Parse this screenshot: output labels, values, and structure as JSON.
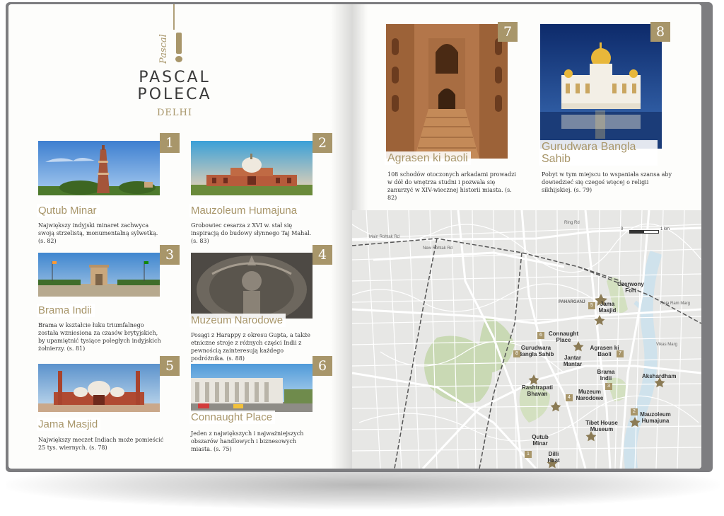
{
  "header": {
    "logo_text": "Pascal",
    "title_line1": "PASCAL",
    "title_line2": "POLECA",
    "city": "DELHI"
  },
  "attractions": [
    {
      "number": "1",
      "name": "Qutub Minar",
      "description": "Największy indyjski minaret zachwyca swoją strzelistą, monumentalną sylwetką. (s. 82)"
    },
    {
      "number": "2",
      "name": "Mauzoleum Humajuna",
      "description": "Grobowiec cesarza z XVI w. stał się inspiracją do budowy słynnego Taj Mahal. (s. 83)"
    },
    {
      "number": "3",
      "name": "Brama Indii",
      "description": "Brama w kształcie łuku triumfalnego została wzniesiona za czasów brytyjskich, by upamiętnić tysiące poległych indyjskich żołnierzy. (s. 81)"
    },
    {
      "number": "4",
      "name": "Muzeum Narodowe",
      "description": "Posągi z Harappy z okresu Gupta, a także etniczne stroje z różnych części Indii z pewnością zainteresują każdego podróżnika. (s. 88)"
    },
    {
      "number": "5",
      "name": "Jama Masjid",
      "description": "Największy meczet Indiach może pomieścić 25 tys. wiernych. (s. 78)"
    },
    {
      "number": "6",
      "name": "Connaught Place",
      "description": "Jeden z największych i najważniejszych obszarów handlowych i biznesowych miasta. (s. 75)"
    },
    {
      "number": "7",
      "name": "Agrasen ki baoli",
      "description": "108 schodów otoczonych arkadami prowadzi w dół do wnętrza studni i pozwala się zanurzyć w XIV-wiecznej historii miasta. (s. 82)"
    },
    {
      "number": "8",
      "name": "Gurudwara Bangla Sahib",
      "description": "Pobyt w tym miejscu to wspaniała szansa aby dowiedzieć się czegoś więcej o religii sikhijskiej. (s. 79)"
    }
  ],
  "map": {
    "scale_start": "0",
    "scale_end": "1 km",
    "labels": {
      "czerwony_fort": "Czerwony Fort",
      "jama_masjid": "Jama Masjid",
      "connaught_place": "Connaught Place",
      "gurudwara": "Gurudwara Bangla Sahib",
      "agrasen": "Agrasen ki Baoli",
      "jantar_mantar": "Jantar Mantar",
      "brama_indii": "Brama Indii",
      "rashtrapati": "Rashtrapati Bhavan",
      "muzeum": "Muzeum Narodowe",
      "akshardham": "Akshardham",
      "tibet_house": "Tibet House Museum",
      "mauzoleum": "Mauzoleum Humajuna",
      "qutub": "Qutub Minar",
      "dilli_haat": "Dilli Haat",
      "paharganj": "PAHARGANJ",
      "main_rohtak": "Main Rohtak Rd",
      "new_rohtak": "New Rohtak Rd",
      "raja_ram": "Raja Ram Marg",
      "vikas_marg": "Vikas Marg",
      "ring_rd": "Ring Rd"
    }
  },
  "colors": {
    "accent": "#a8966a",
    "map_bg": "#e7e7e5",
    "park": "#c9d9b4",
    "water": "#cfe2ec",
    "road": "#ffffff"
  }
}
